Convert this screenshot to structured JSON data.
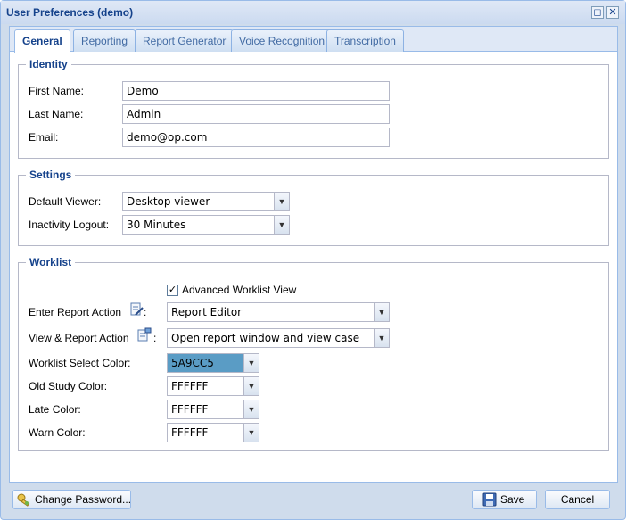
{
  "window": {
    "title": "User Preferences (demo)",
    "maximize_glyph": "◻",
    "close_glyph": "✕"
  },
  "tabs": [
    {
      "label": "General",
      "active": true
    },
    {
      "label": "Reporting",
      "active": false
    },
    {
      "label": "Report Generator",
      "active": false
    },
    {
      "label": "Voice Recognition",
      "active": false
    },
    {
      "label": "Transcription",
      "active": false
    }
  ],
  "identity": {
    "legend": "Identity",
    "first_name_label": "First Name:",
    "first_name_value": "Demo",
    "last_name_label": "Last Name:",
    "last_name_value": "Admin",
    "email_label": "Email:",
    "email_value": "demo@op.com"
  },
  "settings": {
    "legend": "Settings",
    "default_viewer_label": "Default Viewer:",
    "default_viewer_value": "Desktop viewer",
    "inactivity_label": "Inactivity Logout:",
    "inactivity_value": "30 Minutes"
  },
  "worklist": {
    "legend": "Worklist",
    "advanced_view_label": "Advanced Worklist View",
    "advanced_view_checked": true,
    "enter_report_label": "Enter Report Action",
    "enter_report_colon": ":",
    "enter_report_value": "Report Editor",
    "view_report_label": "View & Report Action",
    "view_report_colon": ":",
    "view_report_value": "Open report window and view case",
    "select_color_label": "Worklist Select Color:",
    "select_color_value": "5A9CC5",
    "old_study_label": "Old Study Color:",
    "old_study_value": "FFFFFF",
    "late_label": "Late Color:",
    "late_value": "FFFFFF",
    "warn_label": "Warn Color:",
    "warn_value": "FFFFFF"
  },
  "footer": {
    "change_password_label": "Change Password...",
    "save_label": "Save",
    "cancel_label": "Cancel"
  },
  "colors": {
    "select_color_swatch": "#5A9CC5",
    "accent": "#15428b"
  },
  "icons": {
    "change_password": "key-icon",
    "save": "floppy-disk-icon",
    "enter_report": "report-edit-icon",
    "view_report": "report-view-icon",
    "dropdown": "chevron-down-icon"
  }
}
